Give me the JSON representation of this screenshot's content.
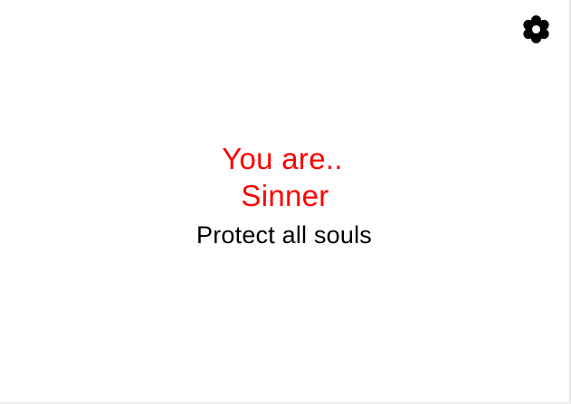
{
  "settings": {
    "icon": "gear-icon",
    "color": "#000000"
  },
  "role": {
    "prefix": "You are..",
    "name": "Sinner",
    "color": "#ff0000"
  },
  "objective": {
    "text": "Protect all souls",
    "color": "#000000"
  }
}
